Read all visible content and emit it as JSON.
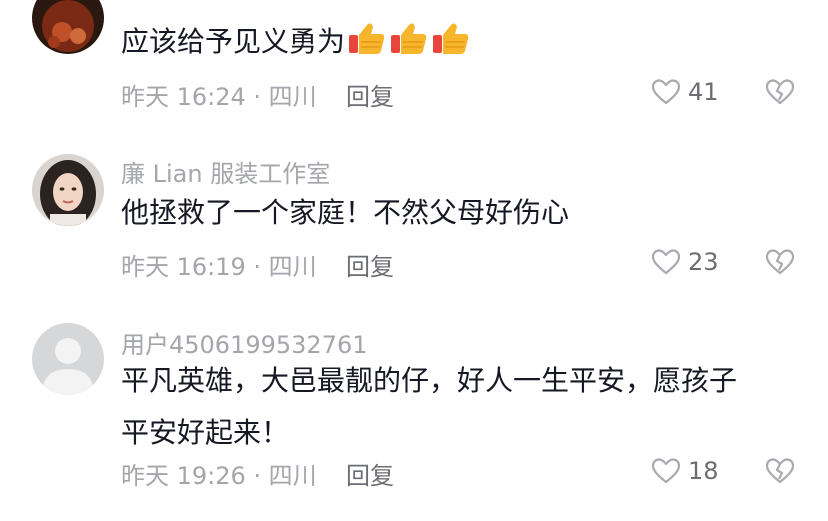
{
  "comments": [
    {
      "username": "",
      "content": "应该给予见义勇为",
      "emojis": [
        "thumbs-up-icon",
        "thumbs-up-icon",
        "thumbs-up-icon"
      ],
      "meta": "昨天 16:24 · 四川",
      "reply_label": "回复",
      "likes": "41"
    },
    {
      "username": "廉 Lian 服装工作室",
      "content": "他拯救了一个家庭！不然父母好伤心",
      "meta": "昨天 16:19 · 四川",
      "reply_label": "回复",
      "likes": "23"
    },
    {
      "username": "用户4506199532761",
      "content_line1": "平凡英雄，大邑最靓的仔，好人一生平安，愿孩子",
      "content_line2": "平安好起来！",
      "meta": "昨天 19:26 · 四川",
      "reply_label": "回复",
      "likes": "18"
    }
  ],
  "colors": {
    "text_primary": "#161823",
    "text_secondary": "#a4a6ab",
    "icon": "#a8aab0",
    "emoji_yellow": "#f7b52c",
    "emoji_red": "#e8453c"
  }
}
